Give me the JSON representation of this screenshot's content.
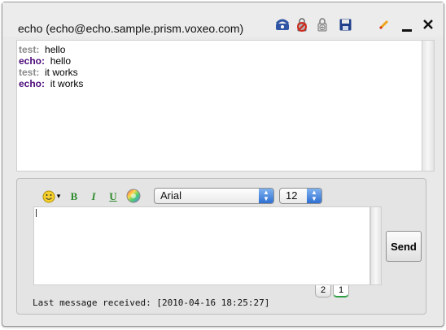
{
  "window": {
    "title": "echo (echo@echo.sample.prism.voxeo.com)"
  },
  "toolbar_icons": [
    {
      "name": "phone-icon",
      "glyph": "☎",
      "color": "#2f55a4"
    },
    {
      "name": "lock-blocked-icon",
      "glyph": "🔒",
      "color": "#c0392b"
    },
    {
      "name": "lock-add-icon",
      "glyph": "🔓",
      "color": "#666666"
    },
    {
      "name": "save-icon",
      "glyph": "💾",
      "color": "#1f3f8a"
    },
    {
      "name": "pencil-icon",
      "glyph": "✎",
      "color": "#e68a00"
    },
    {
      "name": "minimize-icon",
      "glyph": "—",
      "color": "#111111"
    },
    {
      "name": "close-icon",
      "glyph": "✕",
      "color": "#111111"
    }
  ],
  "messages": [
    {
      "sender": "test:",
      "text": "hello"
    },
    {
      "sender": "echo:",
      "text": "hello"
    },
    {
      "sender": "test:",
      "text": "it works"
    },
    {
      "sender": "echo:",
      "text": "it works"
    }
  ],
  "format_toolbar": {
    "emoji_glyph": "☺",
    "emoji_arrow": "▾",
    "bold": "B",
    "italic": "I",
    "underline": "U",
    "color_glyph": "●",
    "font_family": "Arial",
    "font_size": "12",
    "select_arrows": "▲▼"
  },
  "compose": {
    "input_value": "",
    "send_label": "Send"
  },
  "page_tabs": [
    "2",
    "1"
  ],
  "status": {
    "last_received": "Last message received: [2010-04-16 18:25:27]"
  },
  "colors": {
    "sender_test": "#8a8a8a",
    "sender_echo": "#4b0a7a",
    "underline_active_tab": "#2ea043"
  }
}
